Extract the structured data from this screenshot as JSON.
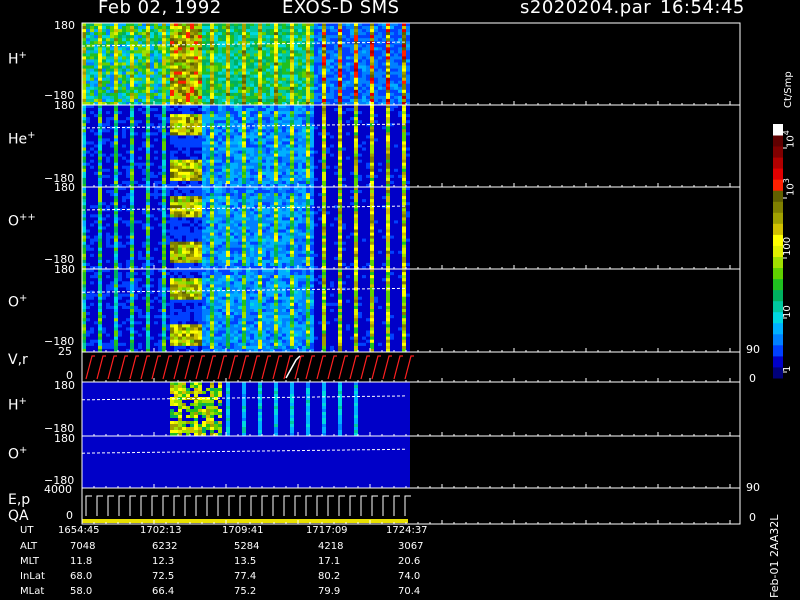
{
  "header": {
    "date": "Feb 02, 1992",
    "mission": "EXOS-D SMS",
    "file": "s2020204.par",
    "time": "16:54:45"
  },
  "colorbar": {
    "title": "Ct/Smp",
    "labels": [
      "1",
      "10",
      "100",
      "10",
      "10"
    ],
    "exponents": [
      "",
      "",
      "",
      "3",
      "4"
    ],
    "colors": [
      "#00007a",
      "#0000c8",
      "#0040ff",
      "#0080ff",
      "#00b0ff",
      "#00d8e0",
      "#00c8a0",
      "#00b060",
      "#20c020",
      "#60d000",
      "#a0e000",
      "#e0f000",
      "#ffff00",
      "#d0c000",
      "#a0a000",
      "#808000",
      "#606000",
      "#ff2000",
      "#e00000",
      "#b00000",
      "#800000",
      "#600000",
      "#ffffff"
    ]
  },
  "panels": [
    {
      "id": "h",
      "label": "H",
      "sup": "+",
      "top_tick": "180",
      "bot_tick": "−180"
    },
    {
      "id": "he",
      "label": "He",
      "sup": "+",
      "top_tick": "180",
      "bot_tick": "−180"
    },
    {
      "id": "opp",
      "label": "O",
      "sup": "++",
      "top_tick": "180",
      "bot_tick": "−180"
    },
    {
      "id": "op",
      "label": "O",
      "sup": "+",
      "top_tick": "180",
      "bot_tick": "−180"
    },
    {
      "id": "vr",
      "label": "V,r",
      "sup": "",
      "top_tick": "25",
      "bot_tick": "0",
      "right_top": "90",
      "right_bot": "0"
    },
    {
      "id": "h2",
      "label": "H",
      "sup": "+",
      "top_tick": "180",
      "bot_tick": "−180"
    },
    {
      "id": "o2",
      "label": "O",
      "sup": "+",
      "top_tick": "180",
      "bot_tick": "−180"
    },
    {
      "id": "ep",
      "label": "E,p",
      "sub_label": "QA",
      "sup": "",
      "top_tick": "4000",
      "bot_tick": "0",
      "right_top": "90",
      "right_bot": "0"
    }
  ],
  "footer": {
    "row_labels": [
      "UT",
      "ALT",
      "MLT",
      "InLat",
      "MLat"
    ],
    "columns": [
      [
        "1654:45",
        "7048",
        "11.8",
        "68.0",
        "58.0"
      ],
      [
        "1702:13",
        "6232",
        "12.3",
        "72.5",
        "66.4"
      ],
      [
        "1709:41",
        "5284",
        "13.5",
        "77.4",
        "75.2"
      ],
      [
        "1717:09",
        "4218",
        "17.1",
        "80.2",
        "79.9"
      ],
      [
        "1724:37",
        "3067",
        "20.6",
        "74.0",
        "70.4"
      ]
    ],
    "vertical_note": "Feb-01 2AA32L"
  },
  "chart_data": {
    "type": "heatmap",
    "title": "Feb 02, 1992   EXOS-D SMS",
    "x_tick_labels": [
      "1654:45",
      "1702:13",
      "1709:41",
      "1717:09",
      "1724:37"
    ],
    "y_range": [
      -180,
      180
    ],
    "colorbar_range": [
      1,
      10000
    ],
    "colorbar_scale": "log",
    "colorbar_unit": "Ct/Smp",
    "series": [
      {
        "name": "H+"
      },
      {
        "name": "He+"
      },
      {
        "name": "O++"
      },
      {
        "name": "O+"
      },
      {
        "name": "V,r",
        "ylim": [
          0,
          25
        ],
        "y2lim": [
          0,
          90
        ]
      },
      {
        "name": "H+"
      },
      {
        "name": "O+"
      },
      {
        "name": "E,p",
        "ylim": [
          0,
          4000
        ],
        "y2lim": [
          0,
          90
        ]
      }
    ]
  }
}
